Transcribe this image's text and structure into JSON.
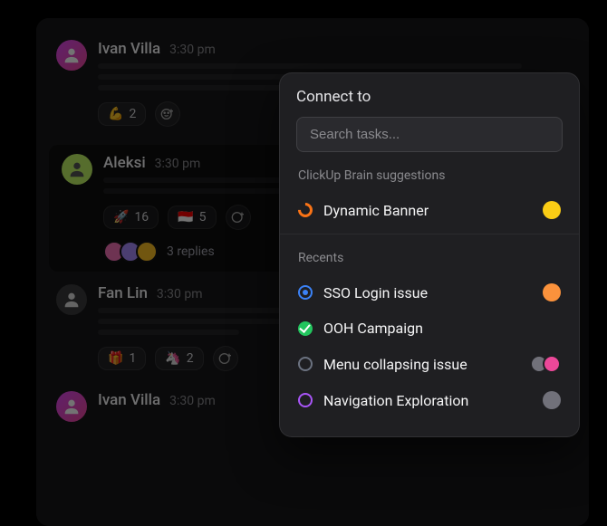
{
  "messages": [
    {
      "name": "Ivan Villa",
      "time": "3:30 pm",
      "avatar_bg": "pink",
      "reactions": [
        {
          "emoji": "💪",
          "count": "2"
        }
      ]
    },
    {
      "name": "Aleksi",
      "time": "3:30 pm",
      "avatar_bg": "lime",
      "reactions": [
        {
          "emoji": "🚀",
          "count": "16"
        },
        {
          "emoji": "🇮🇩",
          "count": "5"
        }
      ],
      "replies_text": "3 replies"
    },
    {
      "name": "Fan Lin",
      "time": "3:30 pm",
      "avatar_bg": "grey",
      "reactions": [
        {
          "emoji": "🎁",
          "count": "1"
        },
        {
          "emoji": "🦄",
          "count": "2"
        }
      ]
    },
    {
      "name": "Ivan Villa",
      "time": "3:30 pm",
      "avatar_bg": "pink"
    }
  ],
  "popover": {
    "title": "Connect to",
    "search_placeholder": "Search tasks...",
    "suggestions_label": "ClickUp Brain suggestions",
    "recents_label": "Recents",
    "suggestions": [
      {
        "name": "Dynamic Banner",
        "status_color": "#f97316",
        "status_kind": "progress",
        "assignee": "yellow"
      }
    ],
    "recents": [
      {
        "name": "SSO Login issue",
        "status_color": "#3b82f6",
        "status_kind": "ring",
        "assignee": "orange"
      },
      {
        "name": "OOH Campaign",
        "status_color": "#22c55e",
        "status_kind": "check",
        "assignee": "none"
      },
      {
        "name": "Menu collapsing issue",
        "status_color": "#a1a1aa",
        "status_kind": "ring",
        "assignee": "stack"
      },
      {
        "name": "Navigation Exploration",
        "status_color": "#a855f7",
        "status_kind": "ring",
        "assignee": "grey"
      }
    ]
  }
}
